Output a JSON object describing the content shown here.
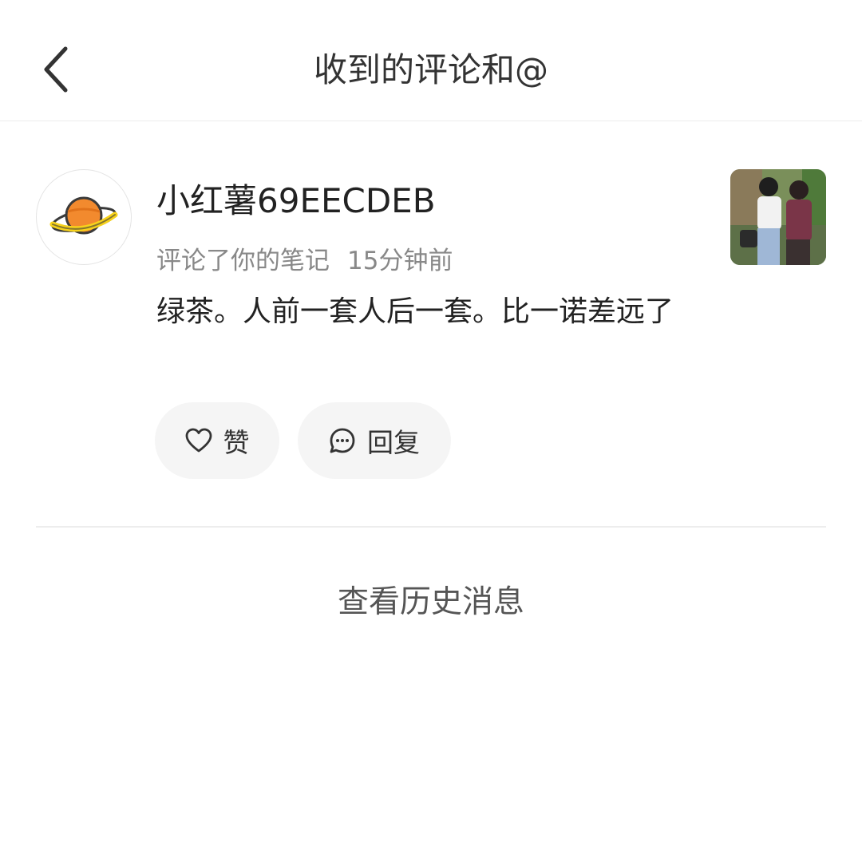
{
  "header": {
    "title": "收到的评论和@",
    "back_icon": "chevron-left-icon"
  },
  "notification": {
    "avatar_icon": "planet-icon",
    "avatar_colors": {
      "planet": "#f28a2e",
      "ring": "#f7d21b"
    },
    "username": "小红薯69EECDEB",
    "action": "评论了你的笔记",
    "time": "15分钟前",
    "comment": "绿茶。人前一套人后一套。比一诺差远了",
    "note_thumbnail": "note-thumbnail-photo",
    "buttons": {
      "like": {
        "icon": "heart-icon",
        "label": "赞"
      },
      "reply": {
        "icon": "chat-bubble-icon",
        "label": "回复"
      }
    }
  },
  "history_link": "查看历史消息"
}
